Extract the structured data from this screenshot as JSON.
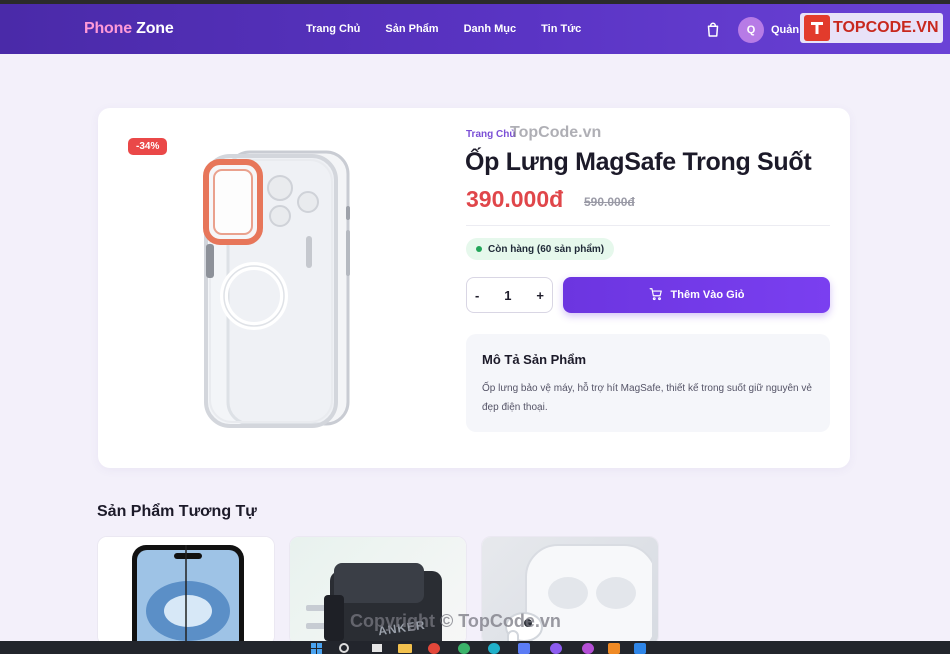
{
  "header": {
    "logo_part1": "Phone",
    "logo_part2": "Zone",
    "nav": [
      "Trang Chủ",
      "Sản Phẩm",
      "Danh Mục",
      "Tin Tức"
    ],
    "avatar_initial": "Q",
    "user_label": "Quản",
    "watermark_brand": "TOPCODE.VN"
  },
  "product": {
    "discount_badge": "-34%",
    "breadcrumb": "Trang Chủ",
    "breadcrumb_watermark": "TopCode.vn",
    "title": "Ốp Lưng MagSafe Trong Suốt",
    "price": "390.000đ",
    "old_price": "590.000đ",
    "stock_status": "Còn hàng (60 sản phẩm)",
    "quantity": "1",
    "minus_label": "-",
    "plus_label": "+",
    "add_to_cart_label": "Thêm Vào Giỏ",
    "description_title": "Mô Tả Sản Phẩm",
    "description_text": "Ốp lưng bảo vệ máy, hỗ trợ hít MagSafe, thiết kế trong suốt giữ nguyên vẻ đẹp điện thoại."
  },
  "similar": {
    "heading": "Sản Phẩm Tương Tự",
    "items": [
      {
        "icon": "screen-protector-image"
      },
      {
        "icon": "anker-charger-image",
        "brand_text": "ANKER"
      },
      {
        "icon": "airpods-image"
      }
    ]
  },
  "footer_watermark": "Copyright © TopCode.vn",
  "colors": {
    "accent": "#7a3ff0",
    "price": "#e0464a",
    "badge": "#ea4848",
    "stock": "#22a559"
  }
}
